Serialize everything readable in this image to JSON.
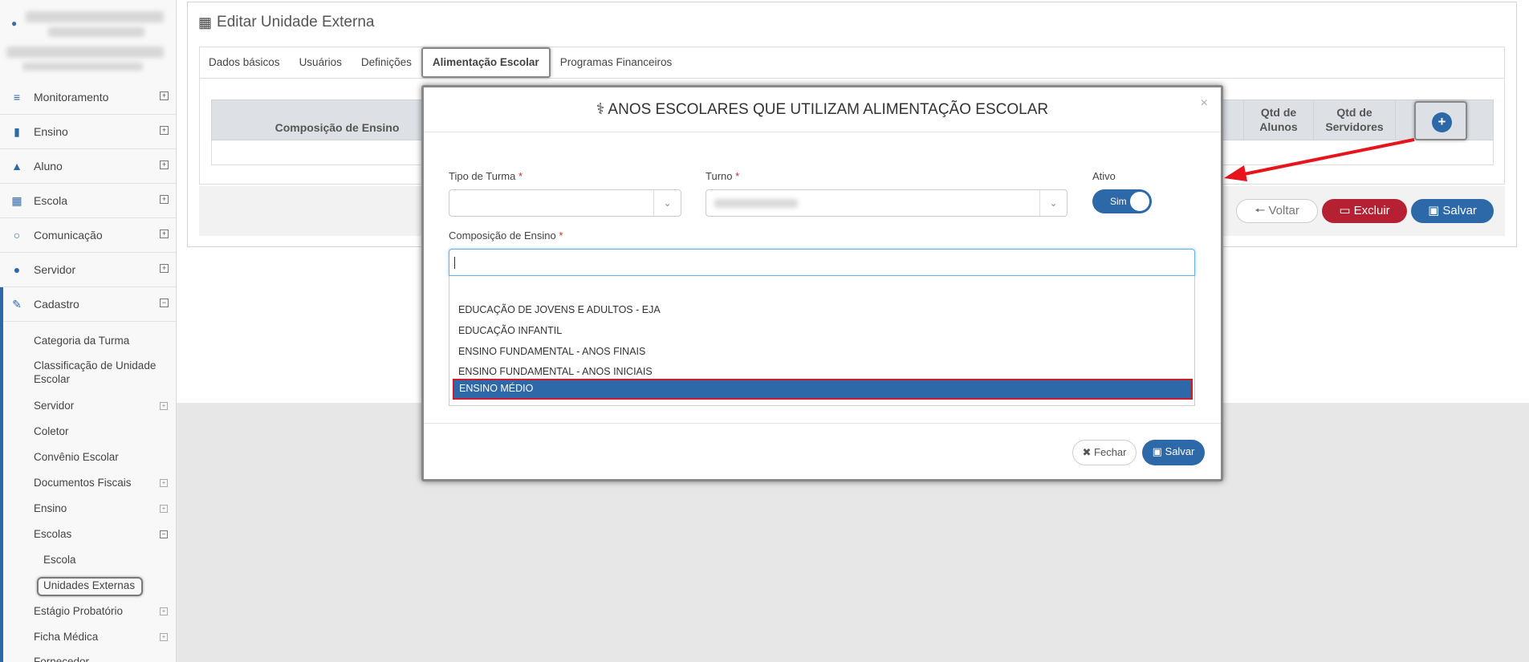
{
  "sidebar": {
    "menu": [
      {
        "label": "Monitoramento",
        "icon": "sliders-icon",
        "toggle": "+"
      },
      {
        "label": "Ensino",
        "icon": "book-icon",
        "toggle": "+"
      },
      {
        "label": "Aluno",
        "icon": "graduation-cap-icon",
        "toggle": "+"
      },
      {
        "label": "Escola",
        "icon": "institution-icon",
        "toggle": "+"
      },
      {
        "label": "Comunicação",
        "icon": "chat-bubble-icon",
        "toggle": "+"
      },
      {
        "label": "Servidor",
        "icon": "user-icon",
        "toggle": "+"
      },
      {
        "label": "Cadastro",
        "icon": "edit-icon",
        "toggle": "−"
      }
    ],
    "cadastro_items": [
      {
        "label": "Categoria da Turma"
      },
      {
        "label": "Classificação de Unidade Escolar"
      },
      {
        "label": "Servidor"
      },
      {
        "label": "Coletor"
      },
      {
        "label": "Convênio Escolar"
      },
      {
        "label": "Documentos Fiscais"
      },
      {
        "label": "Ensino"
      },
      {
        "label": "Escolas"
      },
      {
        "label": "Escola"
      },
      {
        "label": "Unidades Externas"
      },
      {
        "label": "Estágio Probatório"
      },
      {
        "label": "Ficha Médica"
      },
      {
        "label": "Fornecedor"
      }
    ]
  },
  "page": {
    "title": "Editar Unidade Externa",
    "tabs": [
      {
        "label": "Dados básicos"
      },
      {
        "label": "Usuários"
      },
      {
        "label": "Definições"
      },
      {
        "label": "Alimentação Escolar"
      },
      {
        "label": "Programas Financeiros"
      }
    ],
    "grid": {
      "col_composicao": "Composição de Ensino",
      "col_qtd_alunos": "Qtd de Alunos",
      "col_qtd_servidores": "Qtd de Servidores",
      "add_label": "+"
    },
    "buttons": {
      "voltar": "Voltar",
      "excluir": "Excluir",
      "salvar": "Salvar"
    }
  },
  "modal": {
    "title": "ANOS ESCOLARES QUE UTILIZAM ALIMENTAÇÃO ESCOLAR",
    "close": "×",
    "tipo_turma_label": "Tipo de Turma",
    "turno_label": "Turno",
    "ativo_label": "Ativo",
    "ativo_value": "Sim",
    "composicao_label": "Composição de Ensino",
    "required_mark": "*",
    "options": [
      {
        "label": "EDUCAÇÃO DE JOVENS E ADULTOS - EJA"
      },
      {
        "label": "EDUCAÇÃO INFANTIL"
      },
      {
        "label": "ENSINO FUNDAMENTAL - ANOS FINAIS"
      },
      {
        "label": "ENSINO FUNDAMENTAL - ANOS INICIAIS"
      }
    ],
    "selected_option": "ENSINO MÉDIO",
    "fechar": "Fechar",
    "salvar": "Salvar"
  },
  "colors": {
    "primary": "#2d68a8",
    "danger": "#b52133",
    "highlight_border": "#d11a2a",
    "annotation_arrow": "#e8141c"
  }
}
